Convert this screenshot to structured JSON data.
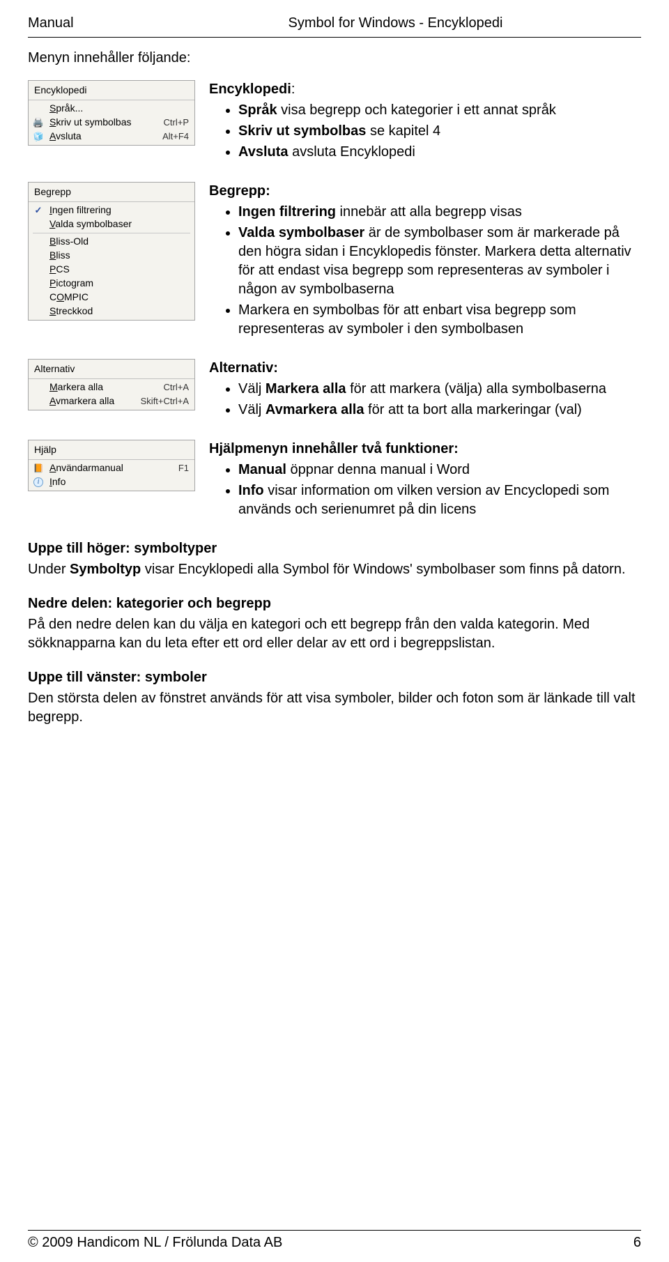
{
  "header": {
    "left": "Manual",
    "center": "Symbol for Windows - Encyklopedi"
  },
  "intro": "Menyn innehåller följande:",
  "menu1": {
    "title": "Encyklopedi",
    "items": [
      {
        "label": "Språk...",
        "shortcut": "",
        "icon": ""
      },
      {
        "label": "Skriv ut symbolbas",
        "shortcut": "Ctrl+P",
        "icon": "printer"
      },
      {
        "label": "Avsluta",
        "shortcut": "Alt+F4",
        "icon": "cube"
      }
    ]
  },
  "desc1": {
    "heading_bold": "Encyklopedi",
    "heading_after": ":",
    "bullets": [
      [
        [
          "b",
          "Språk"
        ],
        " visa begrepp och kategorier i ett annat språk"
      ],
      [
        [
          "b",
          "Skriv ut symbolbas"
        ],
        " se kapitel 4"
      ],
      [
        [
          "b",
          "Avsluta"
        ],
        " avsluta Encyklopedi"
      ]
    ]
  },
  "menu2": {
    "title": "Begrepp",
    "items": [
      {
        "label": "Ingen filtrering",
        "shortcut": "",
        "icon": "check"
      },
      {
        "label": "Valda symbolbaser",
        "shortcut": "",
        "icon": ""
      },
      {
        "label": "Bliss-Old",
        "shortcut": "",
        "icon": ""
      },
      {
        "label": "Bliss",
        "shortcut": "",
        "icon": ""
      },
      {
        "label": "PCS",
        "shortcut": "",
        "icon": ""
      },
      {
        "label": "Pictogram",
        "shortcut": "",
        "icon": ""
      },
      {
        "label": "COMPIC",
        "shortcut": "",
        "icon": ""
      },
      {
        "label": "Streckkod",
        "shortcut": "",
        "icon": ""
      }
    ]
  },
  "desc2": {
    "heading_bold": "Begrepp:",
    "heading_after": "",
    "bullets": [
      [
        [
          "b",
          "Ingen filtrering"
        ],
        " innebär att alla begrepp visas"
      ],
      [
        [
          "b",
          "Valda symbolbaser"
        ],
        " är de symbolbaser som är markerade på den högra sidan i Encyklopedis fönster. Markera detta alternativ för att endast visa begrepp som representeras av symboler i någon av symbolbaserna"
      ],
      [
        "Markera en symbolbas för att enbart visa begrepp som representeras av symboler i den symbolbasen"
      ]
    ]
  },
  "menu3": {
    "title": "Alternativ",
    "items": [
      {
        "label": "Markera alla",
        "shortcut": "Ctrl+A",
        "icon": ""
      },
      {
        "label": "Avmarkera alla",
        "shortcut": "Skift+Ctrl+A",
        "icon": ""
      }
    ]
  },
  "desc3": {
    "heading_bold": "Alternativ:",
    "heading_after": "",
    "bullets": [
      [
        "Välj ",
        [
          "b",
          "Markera alla"
        ],
        " för att markera (välja) alla symbolbaserna"
      ],
      [
        "Välj ",
        [
          "b",
          "Avmarkera alla"
        ],
        " för att ta bort alla markeringar (val)"
      ]
    ]
  },
  "menu4": {
    "title": "Hjälp",
    "items": [
      {
        "label": "Användarmanual",
        "shortcut": "F1",
        "icon": "book"
      },
      {
        "label": "Info",
        "shortcut": "",
        "icon": "info"
      }
    ]
  },
  "desc4": {
    "heading_bold": "Hjälpmenyn innehåller två funktioner:",
    "heading_after": "",
    "bullets": [
      [
        [
          "b",
          "Manual"
        ],
        " öppnar denna manual i Word"
      ],
      [
        [
          "b",
          "Info"
        ],
        " visar information om vilken version av Encyclopedi som används och serienumret på din licens"
      ]
    ]
  },
  "body": {
    "p1_head": "Uppe till höger: symboltyper",
    "p1_a": "Under ",
    "p1_b_bold": "Symboltyp",
    "p1_c": " visar Encyklopedi alla Symbol för Windows' symbolbaser som finns på datorn.",
    "p2_head": "Nedre delen: kategorier och begrepp",
    "p2_a": "På den nedre delen kan du välja en kategori och ett begrepp från den valda kategorin. Med sökknapparna kan du leta efter ett ord eller delar av ett ord i begreppslistan.",
    "p3_head": "Uppe till vänster: symboler",
    "p3_a": "Den största delen av fönstret används för att visa symboler, bilder och foton som är länkade till valt begrepp."
  },
  "footer": {
    "left": "© 2009 Handicom NL / Frölunda Data AB",
    "right": "6"
  }
}
